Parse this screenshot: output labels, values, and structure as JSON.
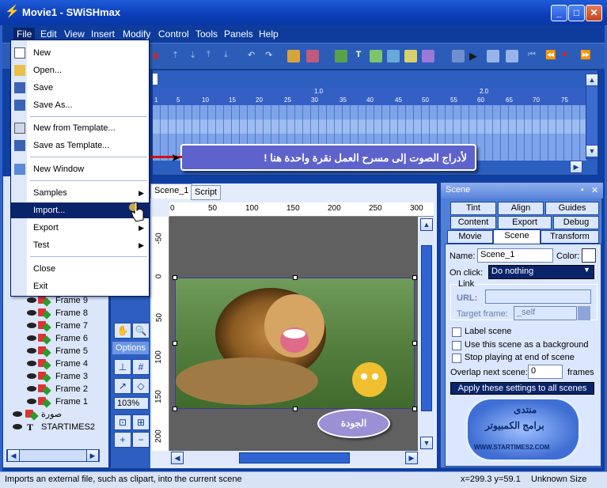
{
  "window": {
    "title": "Movie1 - SWiSHmax",
    "min": "_",
    "max": "□",
    "close": "✕"
  },
  "menubar": [
    "File",
    "Edit",
    "View",
    "Insert",
    "Modify",
    "Control",
    "Tools",
    "Panels",
    "Help"
  ],
  "file_menu": {
    "items": [
      {
        "label": "New"
      },
      {
        "label": "Open..."
      },
      {
        "label": "Save"
      },
      {
        "label": "Save As..."
      },
      {
        "label": "New from Template..."
      },
      {
        "label": "Save as Template..."
      },
      {
        "label": "New Window"
      },
      {
        "label": "Samples"
      },
      {
        "label": "Import..."
      },
      {
        "label": "Export"
      },
      {
        "label": "Test"
      },
      {
        "label": "Close"
      },
      {
        "label": "Exit"
      }
    ]
  },
  "timeline": {
    "ruler_major": [
      "1.0",
      "2.0"
    ],
    "ruler_minor": [
      "1",
      "5",
      "10",
      "15",
      "20",
      "25",
      "30",
      "35",
      "40",
      "45",
      "50",
      "55",
      "60",
      "65",
      "70",
      "75"
    ]
  },
  "callout_text": "لأدراج الصوت إلى مسرح العمل نقرة واحدة هنا !",
  "stage": {
    "tabs": [
      "Scene_1",
      "Script"
    ],
    "h_ticks": [
      "0",
      "50",
      "100",
      "150",
      "200",
      "250",
      "300"
    ],
    "v_ticks": [
      "-50",
      "0",
      "50",
      "100",
      "150",
      "200"
    ],
    "bubble_text": "الجودة"
  },
  "tools": {
    "options_label": "Options",
    "zoom": "103%"
  },
  "outline": {
    "rows": [
      "Frame 9",
      "Frame 8",
      "Frame 7",
      "Frame 6",
      "Frame 5",
      "Frame 4",
      "Frame 3",
      "Frame 2",
      "Frame 1",
      "صورة",
      "STARTIMES2"
    ],
    "text_icon": "T"
  },
  "scene_panel": {
    "header": "Scene",
    "tabs_row1": [
      "Tint",
      "Align",
      "Guides"
    ],
    "tabs_row2": [
      "Content",
      "Export",
      "Debug"
    ],
    "tabs_row3": [
      "Movie",
      "Scene",
      "Transform"
    ],
    "name_label": "Name:",
    "name_value": "Scene_1",
    "color_label": "Color:",
    "onclick_label": "On click:",
    "onclick_value": "Do nothing",
    "link_label": "Link",
    "url_label": "URL:",
    "url_value": "",
    "target_label": "Target frame:",
    "target_value": "_self",
    "chk_label_scene": "Label scene",
    "chk_background": "Use this scene as a background",
    "chk_stop": "Stop playing at end of scene",
    "overlap_label": "Overlap next scene:",
    "overlap_value": "0",
    "frames_label": "frames",
    "apply_button": "Apply these settings to all scenes",
    "logo_text_1": "منتدى",
    "logo_text_2": "برامج الكمبيوتر",
    "logo_url": "WWW.STARTIMES2.COM"
  },
  "statusbar": {
    "hint": "Imports an external file, such as clipart, into the current scene",
    "coords": "x=299.3 y=59.1",
    "size": "Unknown Size"
  },
  "colors": {
    "title": "#0b3eb8",
    "menu_highlight": "#0a246a",
    "panel": "#dbe7ff",
    "callout": "#5e63cc"
  }
}
